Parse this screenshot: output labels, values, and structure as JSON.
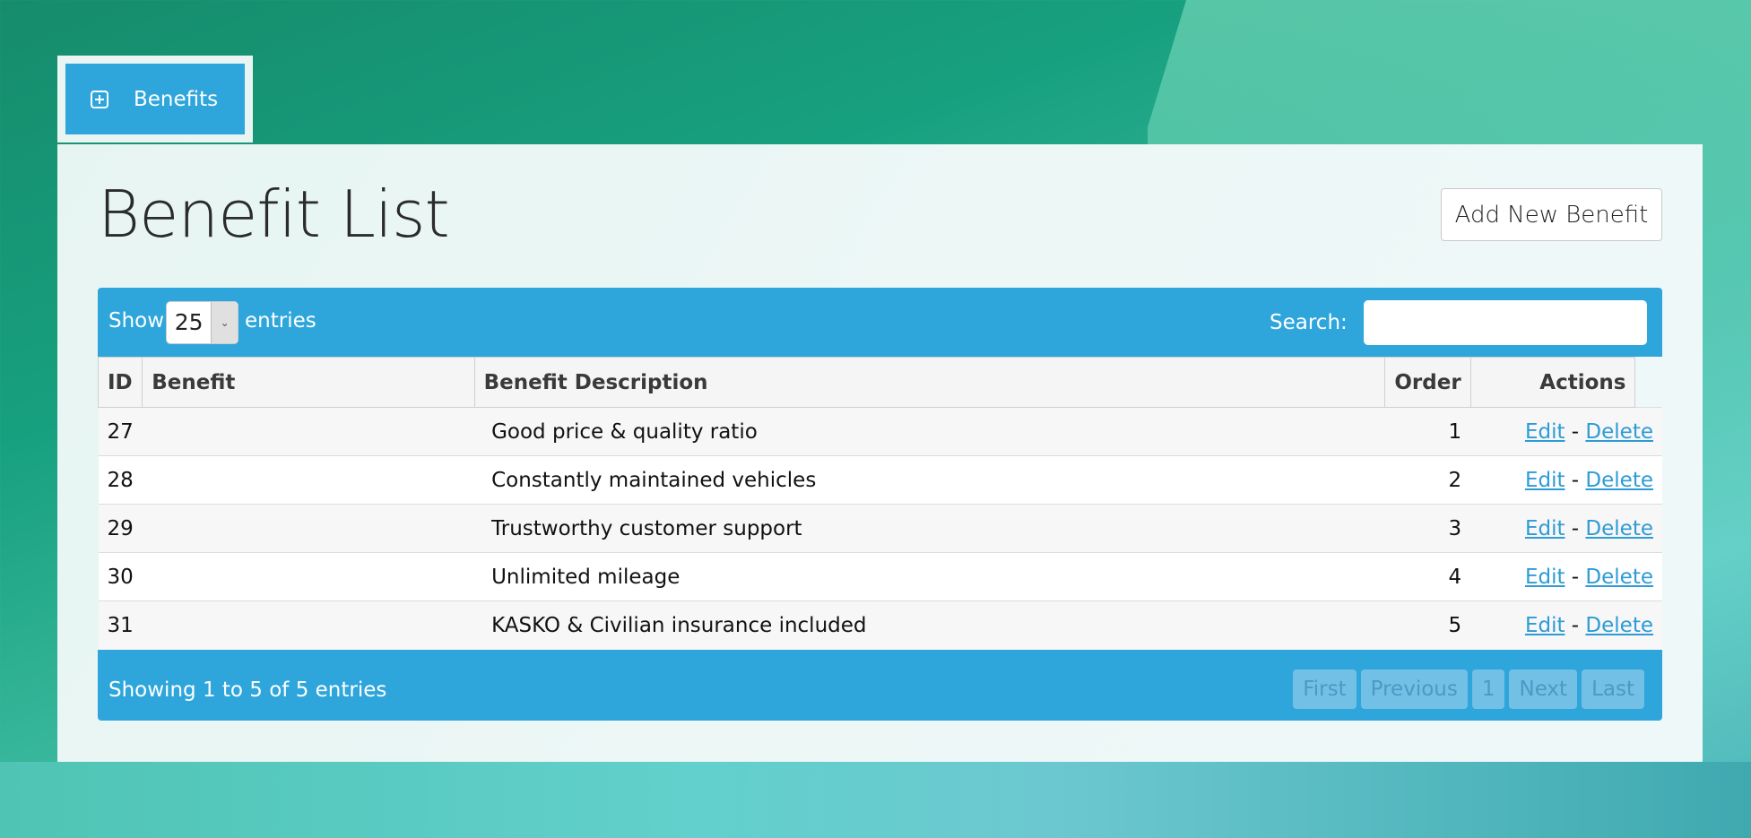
{
  "nav": {
    "tab_label": "Benefits",
    "tab_icon": "plus-square-icon"
  },
  "page": {
    "title": "Benefit List",
    "add_button_label": "Add New Benefit"
  },
  "table_controls": {
    "show_label": "Show",
    "page_size_value": "25",
    "entries_label": "entries",
    "search_label": "Search:",
    "search_value": "",
    "search_placeholder": ""
  },
  "table": {
    "columns": [
      "ID",
      "Benefit",
      "Benefit Description",
      "Order",
      "Actions"
    ],
    "rows": [
      {
        "id": "27",
        "benefit": "",
        "description": "Good price & quality ratio",
        "order": "1",
        "edit": "Edit",
        "sep": "-",
        "delete": "Delete"
      },
      {
        "id": "28",
        "benefit": "",
        "description": "Constantly maintained vehicles",
        "order": "2",
        "edit": "Edit",
        "sep": "-",
        "delete": "Delete"
      },
      {
        "id": "29",
        "benefit": "",
        "description": "Trustworthy customer support",
        "order": "3",
        "edit": "Edit",
        "sep": "-",
        "delete": "Delete"
      },
      {
        "id": "30",
        "benefit": "",
        "description": "Unlimited mileage",
        "order": "4",
        "edit": "Edit",
        "sep": "-",
        "delete": "Delete"
      },
      {
        "id": "31",
        "benefit": "",
        "description": "KASKO & Civilian insurance included",
        "order": "5",
        "edit": "Edit",
        "sep": "-",
        "delete": "Delete"
      }
    ]
  },
  "footer": {
    "info": "Showing 1 to 5 of 5 entries",
    "pagination": [
      "First",
      "Previous",
      "1",
      "Next",
      "Last"
    ]
  },
  "colors": {
    "accent": "#2ea6db",
    "link": "#2e9bd6",
    "pager_disabled_bg": "#72c0e6"
  }
}
